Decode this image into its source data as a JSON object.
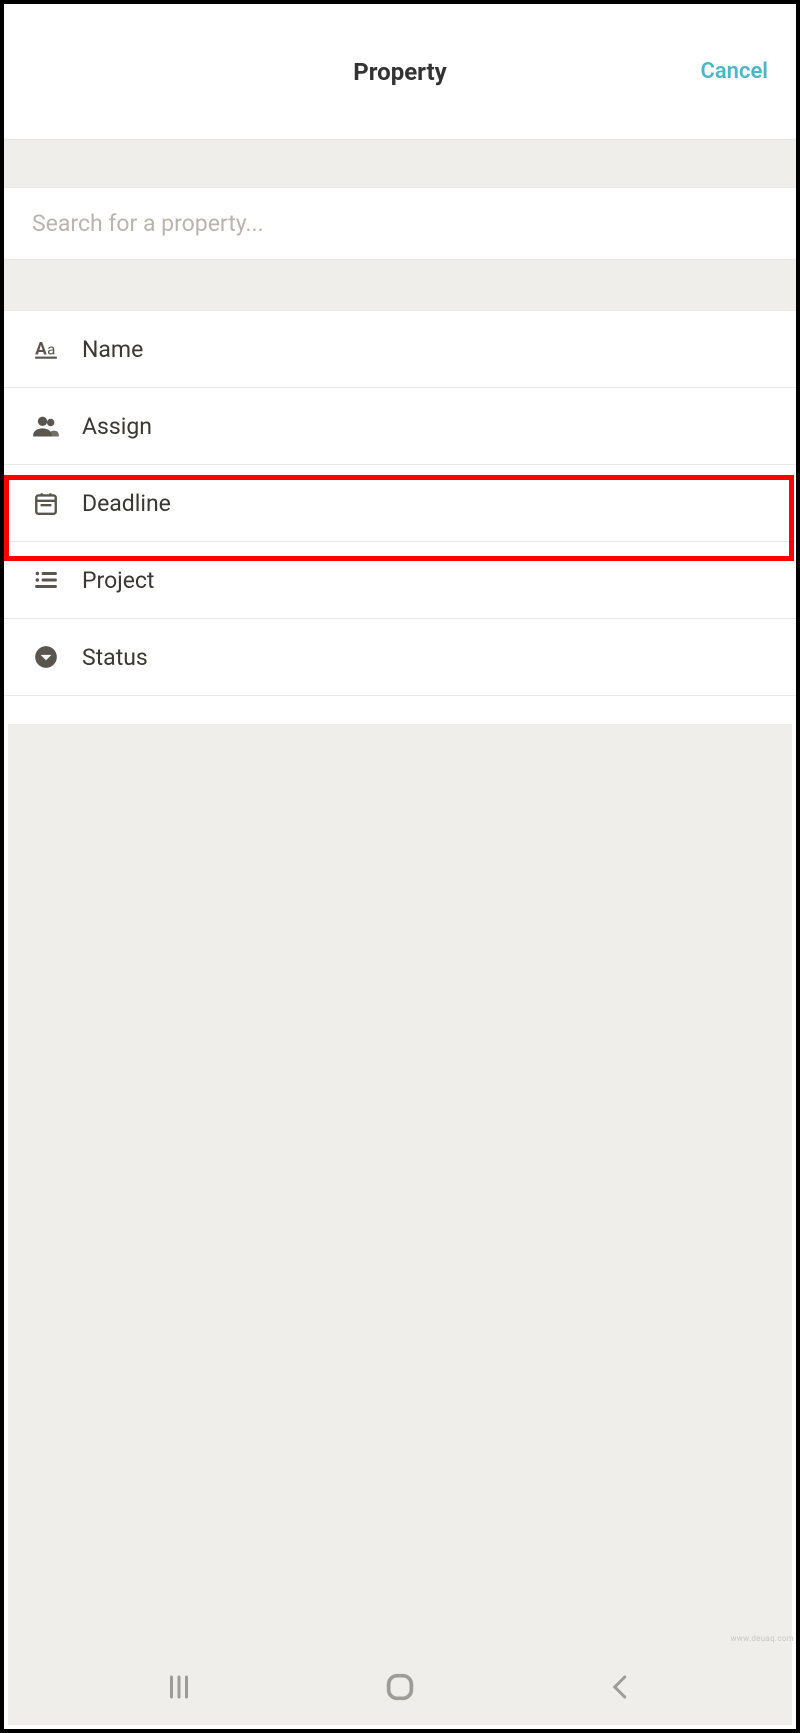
{
  "header": {
    "title": "Property",
    "cancel": "Cancel"
  },
  "search": {
    "placeholder": "Search for a property..."
  },
  "properties": [
    {
      "icon": "text",
      "label": "Name"
    },
    {
      "icon": "people",
      "label": "Assign"
    },
    {
      "icon": "calendar",
      "label": "Deadline"
    },
    {
      "icon": "list",
      "label": "Project"
    },
    {
      "icon": "dropdown",
      "label": "Status"
    }
  ],
  "watermark": "www.deuaq.com"
}
